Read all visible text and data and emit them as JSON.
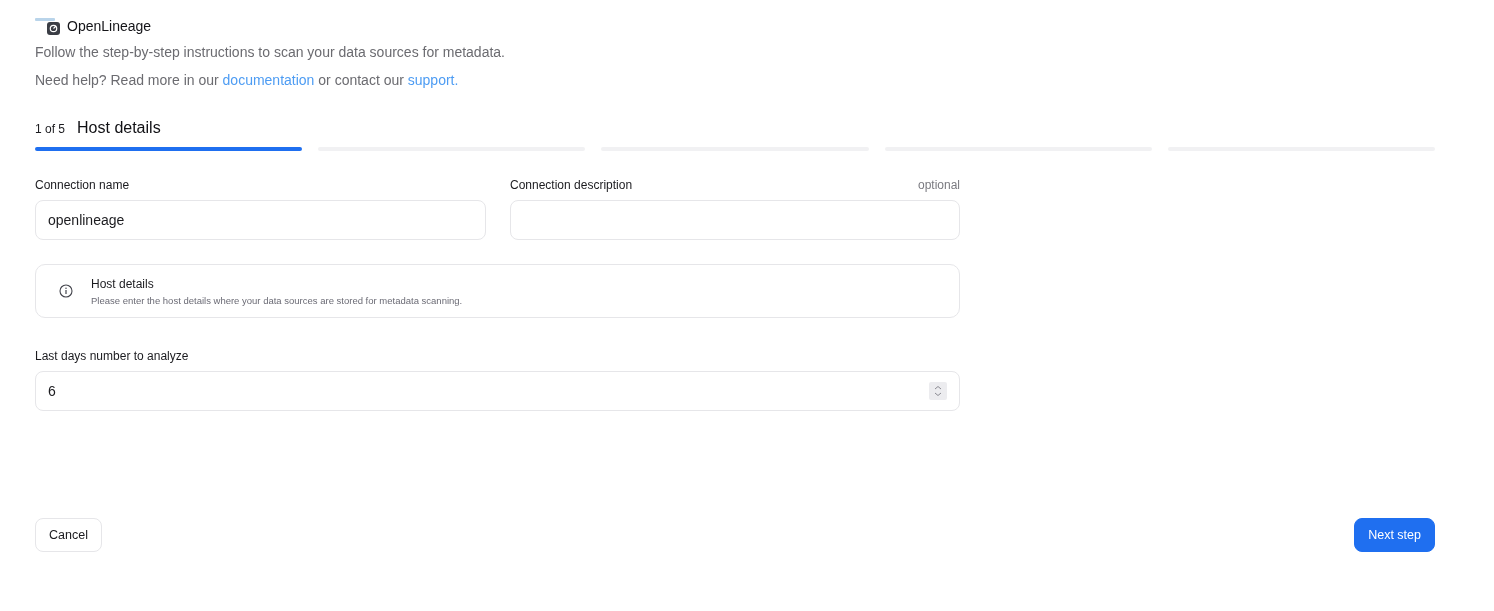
{
  "header": {
    "title": "OpenLineage",
    "subtitle": "Follow the step-by-step instructions to scan your data sources for metadata.",
    "help": {
      "text_before": "Need help? Read more in our",
      "link_1": "documentation",
      "text_middle": "or contact our",
      "link_2": "support."
    }
  },
  "stepper": {
    "counter": "1 of 5",
    "title": "Host details",
    "steps": [
      {
        "selected": true
      },
      {
        "selected": false
      },
      {
        "selected": false
      },
      {
        "selected": false
      },
      {
        "selected": false
      }
    ]
  },
  "fields": [
    {
      "label": "Connection name",
      "value": "openlineage"
    },
    {
      "label": "Connection description",
      "hint": "optional"
    }
  ],
  "info": {
    "title": "Host details",
    "text": "Please enter the host details where your data sources are stored for metadata scanning."
  },
  "number_field": {
    "label": "Last days number to analyze",
    "value": "6"
  },
  "buttons": [
    {
      "label": "Cancel",
      "kind": "secondary"
    },
    {
      "label": "Next step",
      "kind": "primary"
    }
  ]
}
